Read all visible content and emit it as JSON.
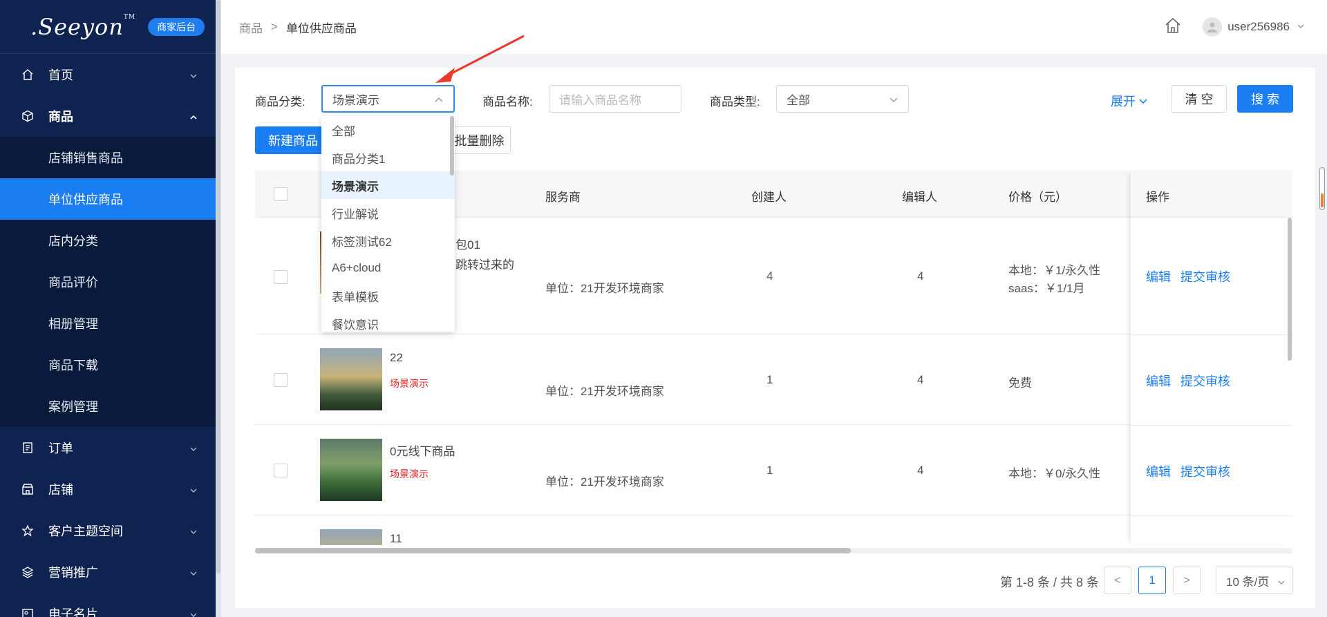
{
  "brand": {
    "logo": ".Seeyon",
    "logo_tm": "TM",
    "badge": "商家后台"
  },
  "sidebar": {
    "items": [
      {
        "label": "首页",
        "icon": "home-icon"
      },
      {
        "label": "商品",
        "icon": "box-icon",
        "expanded": true,
        "children": [
          "店铺销售商品",
          "单位供应商品",
          "店内分类",
          "商品评价",
          "相册管理",
          "商品下载",
          "案例管理"
        ]
      },
      {
        "label": "订单",
        "icon": "order-icon"
      },
      {
        "label": "店铺",
        "icon": "store-icon"
      },
      {
        "label": "客户主题空间",
        "icon": "star-icon"
      },
      {
        "label": "营销推广",
        "icon": "layers-icon"
      },
      {
        "label": "电子名片",
        "icon": "card-icon"
      }
    ],
    "active_child": "单位供应商品"
  },
  "header": {
    "breadcrumb_root": "商品",
    "breadcrumb_sep": ">",
    "breadcrumb_current": "单位供应商品",
    "username": "user256986"
  },
  "filters": {
    "category_label": "商品分类:",
    "category_value": "场景演示",
    "name_label": "商品名称:",
    "name_placeholder": "请输入商品名称",
    "type_label": "商品类型:",
    "type_value": "全部",
    "expand": "展开",
    "clear": "清 空",
    "search": "搜 索"
  },
  "toolbar": {
    "new_product": "新建商品",
    "batch_delete": "批量删除"
  },
  "dropdown": {
    "options": [
      "全部",
      "商品分类1",
      "场景演示",
      "行业解说",
      "标签测试62",
      "A6+cloud",
      "表单模板",
      "餐饮意识"
    ],
    "selected": "场景演示"
  },
  "table": {
    "columns": {
      "service": "服务商",
      "creator": "创建人",
      "editor": "编辑人",
      "price": "价格（元）",
      "action": "操作"
    },
    "rows": [
      {
        "name_line1": "包01",
        "name_line2": "跳转过来的",
        "tag": "",
        "service": "单位：21开发环境商家",
        "creator": "4",
        "editor": "4",
        "price_line1": "本地：￥1/永久性",
        "price_line2": "saas：￥1/1月",
        "edit": "编辑",
        "submit": "提交审核"
      },
      {
        "name_line1": "22",
        "name_line2": "",
        "tag": "场景演示",
        "service": "单位：21开发环境商家",
        "creator": "1",
        "editor": "4",
        "price_line1": "免费",
        "price_line2": "",
        "edit": "编辑",
        "submit": "提交审核"
      },
      {
        "name_line1": "0元线下商品",
        "name_line2": "",
        "tag": "场景演示",
        "service": "单位：21开发环境商家",
        "creator": "1",
        "editor": "4",
        "price_line1": "本地：￥0/永久性",
        "price_line2": "",
        "edit": "编辑",
        "submit": "提交审核"
      },
      {
        "name_line1": "11",
        "name_line2": "",
        "tag": "",
        "service": "",
        "creator": "",
        "editor": "",
        "price_line1": "",
        "price_line2": "",
        "edit": "",
        "submit": ""
      }
    ]
  },
  "pagination": {
    "summary": "第 1-8 条 / 共 8 条",
    "current": "1",
    "prev": "<",
    "next": ">",
    "page_size": "10 条/页"
  },
  "colors": {
    "sidebar_bg": "#0f2350",
    "accent": "#1b7df2",
    "tag_red": "#e02020",
    "annotation_red": "#e8392c"
  }
}
